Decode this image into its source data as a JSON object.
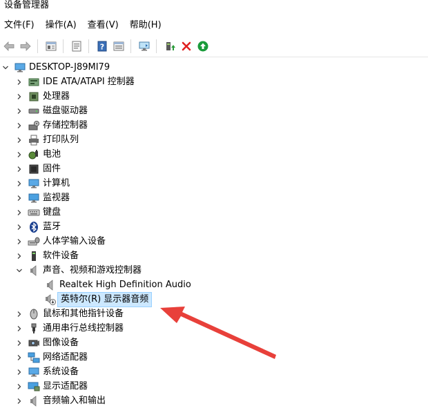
{
  "window": {
    "title": "设备管理器"
  },
  "menu": {
    "items": [
      "文件(F)",
      "操作(A)",
      "查看(V)",
      "帮助(H)"
    ]
  },
  "toolbar": {
    "buttons": [
      {
        "icon": "back-arrow-icon"
      },
      {
        "icon": "forward-arrow-icon"
      },
      {
        "icon": "properties-panel-icon"
      },
      {
        "icon": "details-page-icon"
      },
      {
        "icon": "help-icon"
      },
      {
        "icon": "show-hidden-icon"
      },
      {
        "icon": "scan-hardware-icon"
      },
      {
        "icon": "update-driver-icon"
      },
      {
        "icon": "uninstall-device-icon"
      },
      {
        "icon": "enable-device-icon"
      }
    ]
  },
  "tree": {
    "root": {
      "label": "DESKTOP-J89MI79",
      "expanded": true,
      "icon": "computer-icon"
    },
    "categories": [
      {
        "label": "IDE ATA/ATAPI 控制器",
        "icon": "ide-controller-icon"
      },
      {
        "label": "处理器",
        "icon": "processor-icon"
      },
      {
        "label": "磁盘驱动器",
        "icon": "disk-drive-icon"
      },
      {
        "label": "存储控制器",
        "icon": "storage-controller-icon"
      },
      {
        "label": "打印队列",
        "icon": "printer-icon"
      },
      {
        "label": "电池",
        "icon": "battery-icon"
      },
      {
        "label": "固件",
        "icon": "firmware-icon"
      },
      {
        "label": "计算机",
        "icon": "computer-icon"
      },
      {
        "label": "监视器",
        "icon": "monitor-icon"
      },
      {
        "label": "键盘",
        "icon": "keyboard-icon"
      },
      {
        "label": "蓝牙",
        "icon": "bluetooth-icon"
      },
      {
        "label": "人体学输入设备",
        "icon": "hid-icon"
      },
      {
        "label": "软件设备",
        "icon": "software-device-icon"
      },
      {
        "label": "声音、视频和游戏控制器",
        "icon": "speaker-icon",
        "expanded": true,
        "children": [
          {
            "label": "Realtek High Definition Audio",
            "icon": "speaker-icon"
          },
          {
            "label": "英特尔(R) 显示器音频",
            "icon": "speaker-warning-icon",
            "selected": true
          }
        ]
      },
      {
        "label": "鼠标和其他指针设备",
        "icon": "mouse-icon"
      },
      {
        "label": "通用串行总线控制器",
        "icon": "usb-icon"
      },
      {
        "label": "图像设备",
        "icon": "camera-icon"
      },
      {
        "label": "网络适配器",
        "icon": "network-adapter-icon"
      },
      {
        "label": "系统设备",
        "icon": "system-device-icon"
      },
      {
        "label": "显示适配器",
        "icon": "display-adapter-icon"
      },
      {
        "label": "音频输入和输出",
        "icon": "audio-io-icon"
      }
    ]
  },
  "colors": {
    "selection_bg": "#cce8ff",
    "selection_border": "#99d1ff",
    "annotation_arrow": "#e8403a",
    "uninstall_red": "#e02020",
    "enable_green": "#1a9b3a"
  }
}
